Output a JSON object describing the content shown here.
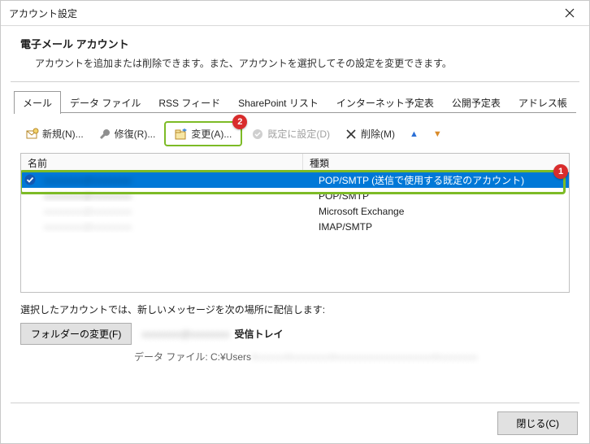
{
  "window": {
    "title": "アカウント設定"
  },
  "header": {
    "title": "電子メール アカウント",
    "description": "アカウントを追加または削除できます。また、アカウントを選択してその設定を変更できます。"
  },
  "tabs": [
    {
      "label": "メール",
      "active": true
    },
    {
      "label": "データ ファイル"
    },
    {
      "label": "RSS フィード"
    },
    {
      "label": "SharePoint リスト"
    },
    {
      "label": "インターネット予定表"
    },
    {
      "label": "公開予定表"
    },
    {
      "label": "アドレス帳"
    }
  ],
  "toolbar": {
    "new_label": "新規(N)...",
    "repair_label": "修復(R)...",
    "change_label": "変更(A)...",
    "set_default_label": "既定に設定(D)",
    "delete_label": "削除(M)",
    "badge_change": "2"
  },
  "list": {
    "columns": {
      "name": "名前",
      "type": "種類"
    },
    "rows": [
      {
        "name": "xxxxxxxx@xxxxxxxx",
        "type": "POP/SMTP (送信で使用する既定のアカウント)",
        "default": true,
        "selected": true
      },
      {
        "name": "xxxxxxxx@xxxxxxxx",
        "type": "POP/SMTP"
      },
      {
        "name": "xxxxxxxx@xxxxxxxx",
        "type": "Microsoft Exchange"
      },
      {
        "name": "xxxxxxxx@xxxxxxxx",
        "type": "IMAP/SMTP"
      }
    ],
    "badge_row": "1"
  },
  "deliver": {
    "label": "選択したアカウントでは、新しいメッセージを次の場所に配信します:",
    "change_folder_label": "フォルダーの変更(F)",
    "target_account": "xxxxxxxx@xxxxxxxx",
    "inbox_label": "受信トレイ",
    "path_prefix": "データ ファイル: C:¥Users",
    "path_rest": "¥xxxxxx¥xxxxxxxx¥xxxxxxxxxxxxxxxxxxxx¥xxxxxxxx"
  },
  "footer": {
    "close_label": "閉じる(C)"
  }
}
